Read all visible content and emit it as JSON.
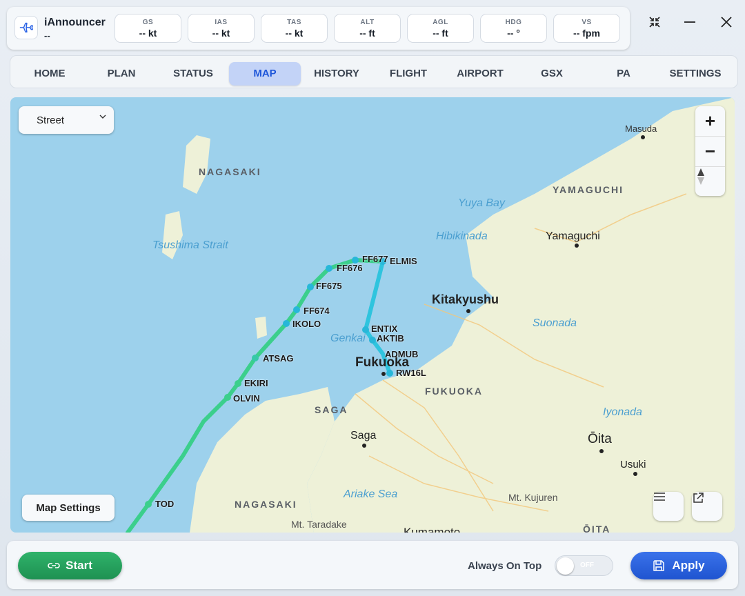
{
  "app": {
    "name": "iAnnouncer",
    "subtitle": "--"
  },
  "stats": [
    {
      "label": "GS",
      "value": "-- kt"
    },
    {
      "label": "IAS",
      "value": "-- kt"
    },
    {
      "label": "TAS",
      "value": "-- kt"
    },
    {
      "label": "ALT",
      "value": "-- ft"
    },
    {
      "label": "AGL",
      "value": "-- ft"
    },
    {
      "label": "HDG",
      "value": "-- °"
    },
    {
      "label": "VS",
      "value": "-- fpm"
    }
  ],
  "window_controls": [
    "collapse-icon",
    "minimize-icon",
    "close-icon"
  ],
  "nav": {
    "tabs": [
      "HOME",
      "PLAN",
      "STATUS",
      "MAP",
      "HISTORY",
      "FLIGHT",
      "AIRPORT",
      "GSX",
      "PA",
      "SETTINGS"
    ],
    "active": "MAP"
  },
  "map": {
    "style_select": "Street",
    "settings_button": "Map Settings",
    "zoom_in": "+",
    "zoom_out": "−",
    "region_labels": [
      "NAGASAKI",
      "YAMAGUCHI",
      "FUKUOKA",
      "SAGA",
      "NAGASAKI",
      "ŌITA"
    ],
    "city_labels": [
      "Masuda",
      "Yamaguchi",
      "Kitakyushu",
      "Fukuoka",
      "Saga",
      "Ōita",
      "Usuki",
      "Mt. Kujuren",
      "Mt. Taradake",
      "Kumamoto"
    ],
    "water_labels": [
      "Tsushima Strait",
      "Yuya Bay",
      "Hibikinada",
      "Suonada",
      "Genkai",
      "Iyonada",
      "Ariake Sea"
    ],
    "waypoints": [
      "FF677",
      "ELMIS",
      "FF676",
      "FF675",
      "FF674",
      "IKOLO",
      "ATSAG",
      "EKIRI",
      "OLVIN",
      "TOD",
      "ENTIX",
      "AKTIB",
      "ADMUB",
      "RW16L"
    ],
    "route_colors": {
      "start": "#3ccf7a",
      "end": "#2fc7e0",
      "water": "#9dd1ec",
      "land": "#eef1d8"
    }
  },
  "footer": {
    "start_label": "Start",
    "always_on_top_label": "Always On Top",
    "toggle_state": "OFF",
    "apply_label": "Apply"
  }
}
